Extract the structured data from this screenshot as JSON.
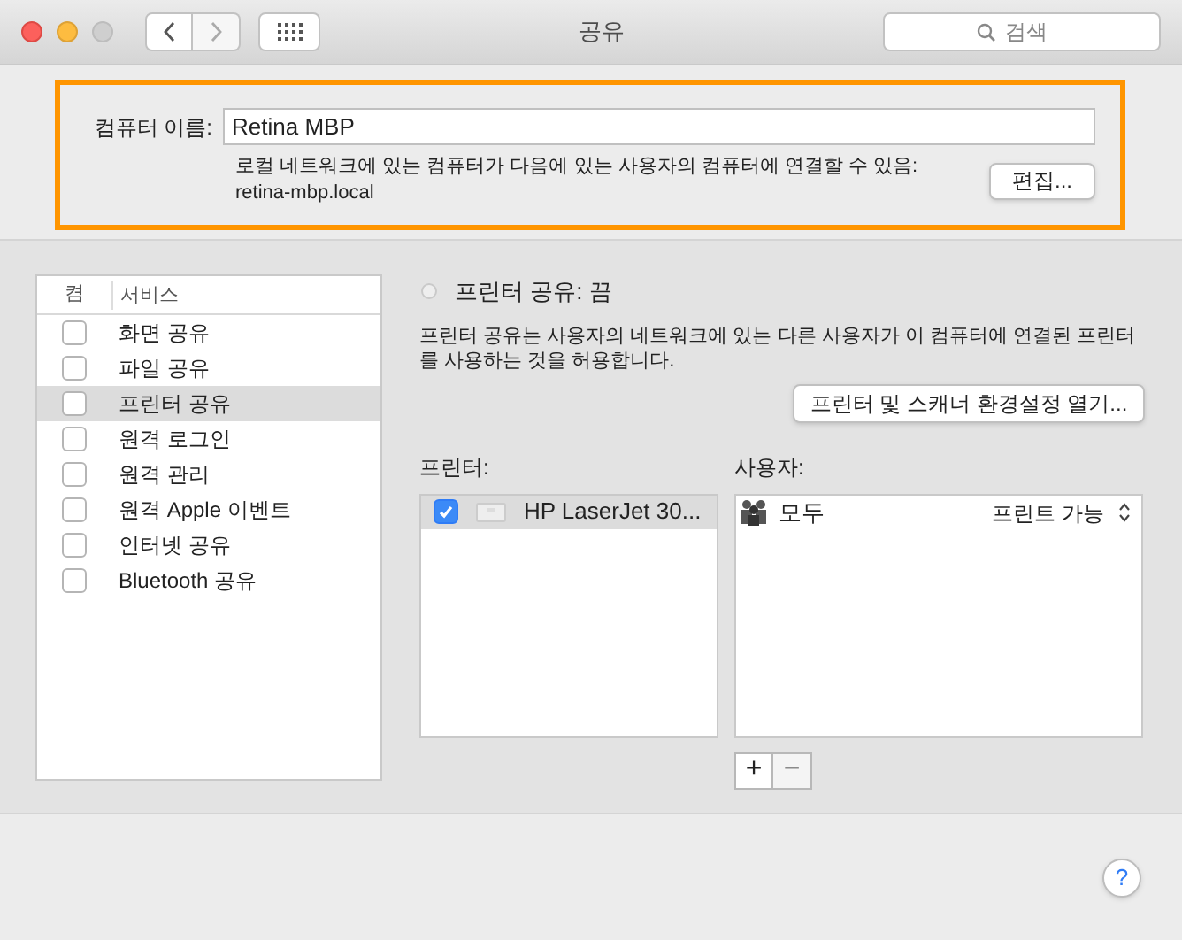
{
  "window": {
    "title": "공유",
    "search": {
      "placeholder": "검색"
    }
  },
  "computer_name": {
    "label": "컴퓨터 이름:",
    "value": "Retina MBP",
    "description": "로컬 네트워크에 있는 컴퓨터가 다음에 있는 사용자의 컴퓨터에 연결할 수 있음:",
    "address": "retina-mbp.local",
    "edit_button": "편집..."
  },
  "services": {
    "columns": [
      "켬",
      "서비스"
    ],
    "items": [
      {
        "name": "화면 공유",
        "checked": false,
        "selected": false
      },
      {
        "name": "파일 공유",
        "checked": false,
        "selected": false
      },
      {
        "name": "프린터 공유",
        "checked": false,
        "selected": true
      },
      {
        "name": "원격 로그인",
        "checked": false,
        "selected": false
      },
      {
        "name": "원격 관리",
        "checked": false,
        "selected": false
      },
      {
        "name": "원격 Apple 이벤트",
        "checked": false,
        "selected": false
      },
      {
        "name": "인터넷 공유",
        "checked": false,
        "selected": false
      },
      {
        "name": "Bluetooth 공유",
        "checked": false,
        "selected": false
      }
    ]
  },
  "detail": {
    "status": "프린터 공유: 끔",
    "status_on": false,
    "description": "프린터 공유는 사용자의 네트워크에 있는 다른 사용자가 이 컴퓨터에 연결된 프린터를 사용하는 것을 허용합니다.",
    "open_button": "프린터 및 스캐너 환경설정 열기...",
    "printers_label": "프린터:",
    "printers": [
      {
        "name": "HP LaserJet 30...",
        "checked": true,
        "selected": true
      }
    ],
    "users_label": "사용자:",
    "users": [
      {
        "name": "모두",
        "permission": "프린트 가능"
      }
    ],
    "add_button": "+",
    "remove_button": "−",
    "remove_disabled": true
  },
  "help_button": "?"
}
